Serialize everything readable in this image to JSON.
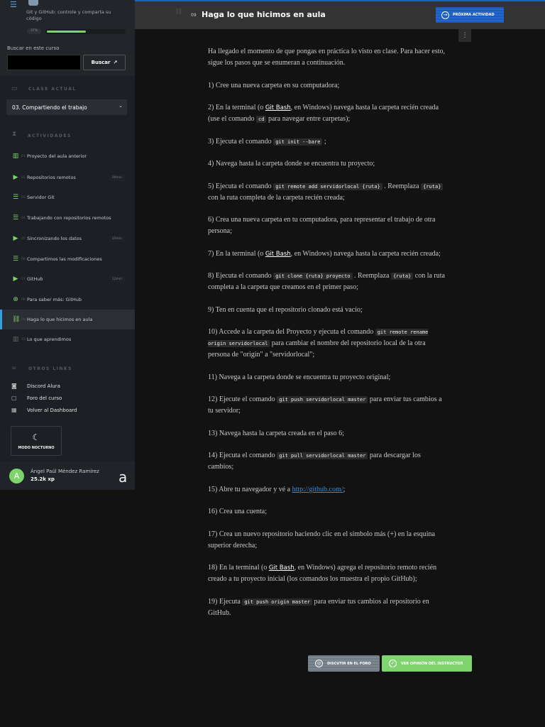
{
  "sidebar": {
    "course_title": "Git y GitHub: controle y comparta su código",
    "progress_label": "37%",
    "progress_percent": 50,
    "search_label": "Buscar en este curso",
    "search_value": "",
    "search_button": "Buscar",
    "current_class_heading": "CLASE ACTUAL",
    "current_class": "03. Compartiendo el trabajo",
    "activities_heading": "ACTIVIDADES",
    "activities": [
      {
        "num": "01",
        "label": "Proyecto del aula anterior",
        "icon": "book-icon",
        "duration": ""
      },
      {
        "num": "02",
        "label": "Repositorios remotos",
        "icon": "video-icon",
        "duration": "09min"
      },
      {
        "num": "03",
        "label": "Servidor Git",
        "icon": "list-icon",
        "duration": ""
      },
      {
        "num": "04",
        "label": "Trabajando con repositorios remotos",
        "icon": "list-icon",
        "duration": ""
      },
      {
        "num": "05",
        "label": "Sincronizando los datos",
        "icon": "video-icon",
        "duration": "10min"
      },
      {
        "num": "06",
        "label": "Compartimos las modificaciones",
        "icon": "list-icon",
        "duration": ""
      },
      {
        "num": "07",
        "label": "GitHub",
        "icon": "video-icon",
        "duration": "12min"
      },
      {
        "num": "08",
        "label": "Para saber más: GitHub",
        "icon": "explore-icon",
        "duration": ""
      },
      {
        "num": "09",
        "label": "Haga lo que hicimos en aula",
        "icon": "practice-icon",
        "duration": ""
      },
      {
        "num": "10",
        "label": "Lo que aprendimos",
        "icon": "book-icon",
        "duration": ""
      }
    ],
    "links_heading": "OTROS LINKS",
    "links": [
      {
        "label": "Discord Alura",
        "icon": "discord-icon"
      },
      {
        "label": "Foro del curso",
        "icon": "forum-icon"
      },
      {
        "label": "Volver al Dashboard",
        "icon": "dashboard-icon"
      }
    ],
    "night_mode": "MODO NOCTURNO",
    "user": {
      "initial": "A",
      "name": "Ángel Paúl Méndez Ramírez",
      "xp": "25.2k xp"
    }
  },
  "header": {
    "num": "09",
    "title": "Haga lo que hicimos en aula",
    "next_button": "PRÓXIMA ACTIVIDAD"
  },
  "content": [
    [
      {
        "t": "Ha llegado el momento de que pongas en práctica lo visto en clase. Para hacer esto, sigue los pasos que se enumeran a continuación."
      }
    ],
    [
      {
        "t": "1) Cree una nueva carpeta en su computadora;"
      }
    ],
    [
      {
        "t": "2) En la terminal (o "
      },
      {
        "s": "Git Bash"
      },
      {
        "t": ", en Windows) navega hasta la carpeta recién creada (use el comando "
      },
      {
        "c": "cd"
      },
      {
        "t": " para navegar entre carpetas);"
      }
    ],
    [
      {
        "t": "3) Ejecuta el comando "
      },
      {
        "c": "git init --bare"
      },
      {
        "t": " ;"
      }
    ],
    [
      {
        "t": "4) Navega hasta la carpeta donde se encuentra tu proyecto;"
      }
    ],
    [
      {
        "t": "5) Ejecuta el comando "
      },
      {
        "c": "git remote add servidorlocal {ruta}"
      },
      {
        "t": " . Reemplaza "
      },
      {
        "c": "{ruta}"
      },
      {
        "t": " con la ruta completa de la carpeta recién creada;"
      }
    ],
    [
      {
        "t": "6) Crea una nueva carpeta en tu computadora, para representar el trabajo de otra persona;"
      }
    ],
    [
      {
        "t": "7) En la terminal (o "
      },
      {
        "s": "Git Bash"
      },
      {
        "t": ", en Windows) navega hasta la carpeta recién creada;"
      }
    ],
    [
      {
        "t": "8) Ejecuta el comando "
      },
      {
        "c": "git clone {ruta} proyecto"
      },
      {
        "t": " . Reemplaza "
      },
      {
        "c": "{ruta}"
      },
      {
        "t": " con la ruta completa a la carpeta que creamos en el primer paso;"
      }
    ],
    [
      {
        "t": "9) Ten en cuenta que el repositorio clonado está vacío;"
      }
    ],
    [
      {
        "t": "10) Accede a la carpeta del Proyecto y ejecuta el comando "
      },
      {
        "c": "git remote rename origin servidorlocal"
      },
      {
        "t": " para cambiar el nombre del repositorio local de la otra persona de \"origin\" a \"servidorlocal\";"
      }
    ],
    [
      {
        "t": "11) Navega a la carpeta donde se encuentra tu proyecto original;"
      }
    ],
    [
      {
        "t": "12) Ejecute el comando "
      },
      {
        "c": "git push servidorlocal master"
      },
      {
        "t": " para enviar tus cambios a tu servidor;"
      }
    ],
    [
      {
        "t": "13) Navega hasta la carpeta creada en el paso 6;"
      }
    ],
    [
      {
        "t": "14) Ejecuta el comando "
      },
      {
        "c": "git pull servidorlocal master"
      },
      {
        "t": " para descargar los cambios;"
      }
    ],
    [
      {
        "t": "15) Abre tu navegador y vé a "
      },
      {
        "l": "http://github.com/"
      },
      {
        "t": ";"
      }
    ],
    [
      {
        "t": "16) Crea una cuenta;"
      }
    ],
    [
      {
        "t": "17) Crea un nuevo repositorio haciendo clic en el símbolo más (+) en la esquina superior derecha;"
      }
    ],
    [
      {
        "t": "18) En la terminal (o "
      },
      {
        "s": "Git Bash"
      },
      {
        "t": ", en Windows) agrega el repositorio remoto recién creado a tu proyecto inicial (los comandos los muestra el propio GitHub);"
      }
    ],
    [
      {
        "t": "19) Ejecuta "
      },
      {
        "c": "git push origin master"
      },
      {
        "t": " para enviar tus cambios al repositorio en GitHub."
      }
    ]
  ],
  "buttons": {
    "forum": "DISCUTIR EN EL FORO",
    "instructor": "VER OPINIÓN DEL INSTRUCTOR"
  },
  "colors": {
    "accent_green": "#7ed36a",
    "accent_blue": "#1e63c4",
    "active_bar": "#2f9fe8"
  }
}
